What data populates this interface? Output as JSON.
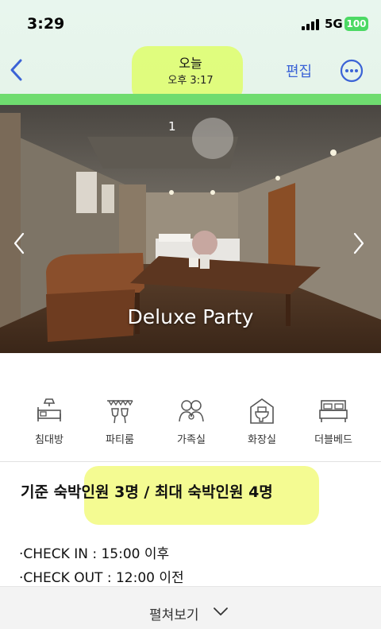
{
  "status_bar": {
    "time": "3:29",
    "network": "5G",
    "battery": "100"
  },
  "nav": {
    "title": "오늘",
    "subtitle": "오후 3:17",
    "edit_label": "편집"
  },
  "hero": {
    "counter": "1",
    "caption": "Deluxe Party"
  },
  "amenities": [
    {
      "label": "침대방",
      "icon": "bed-lamp-icon"
    },
    {
      "label": "파티룸",
      "icon": "party-glasses-icon"
    },
    {
      "label": "가족실",
      "icon": "family-icon"
    },
    {
      "label": "화장실",
      "icon": "toilet-icon"
    },
    {
      "label": "더블베드",
      "icon": "double-bed-icon"
    }
  ],
  "capacity": "기준 숙박인원 3명 / 최대 숙박인원 4명",
  "check_in": "·CHECK IN : 15:00 이후",
  "check_out": "·CHECK OUT : 12:00 이전",
  "expand_label": "펼쳐보기",
  "colors": {
    "accent": "#3b63d6",
    "highlight": "#e7ff5a",
    "green_strip": "#6fdc6f",
    "battery": "#4cd964"
  }
}
